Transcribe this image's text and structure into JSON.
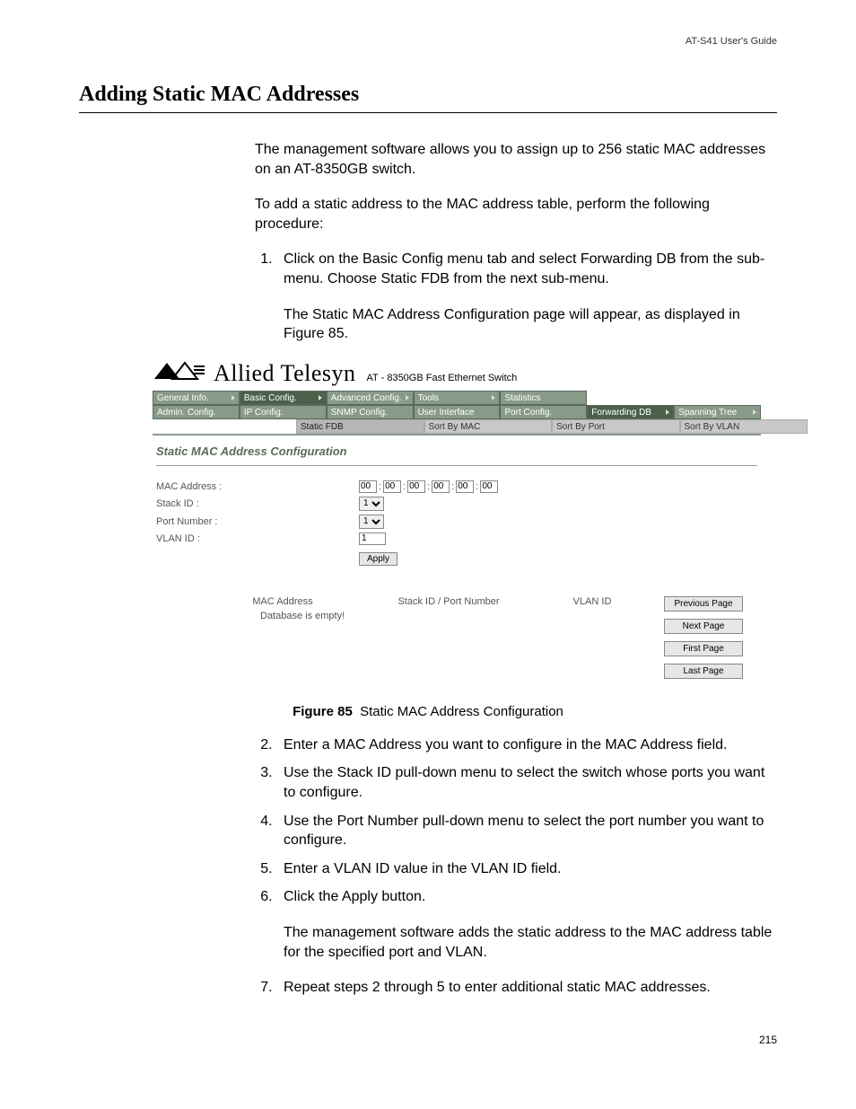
{
  "header": {
    "guide": "AT-S41 User's Guide"
  },
  "heading": "Adding Static MAC Addresses",
  "intro": {
    "p1": "The management software allows you to assign up to 256 static MAC addresses on an AT-8350GB switch.",
    "p2": "To add a static address to the MAC address table, perform the following procedure:"
  },
  "steps_a": {
    "s1": "Click on the Basic Config menu tab and select Forwarding DB from the sub-menu. Choose Static FDB from the next sub-menu.",
    "s1_note": "The Static MAC Address Configuration page will appear, as displayed in Figure 85."
  },
  "screenshot": {
    "logo_text": "Allied Telesyn",
    "logo_sub": "AT - 8350GB Fast Ethernet Switch",
    "tabs_row1": [
      "General Info.",
      "Basic Config.",
      "Advanced Config.",
      "Tools",
      "Statistics"
    ],
    "tabs_row2": [
      "Admin. Config.",
      "IP Config.",
      "SNMP Config.",
      "User Interface",
      "Port Config.",
      "Forwarding DB",
      "Spanning Tree"
    ],
    "tabs_row3": [
      "Static FDB",
      "Sort By MAC",
      "Sort By Port",
      "Sort By VLAN"
    ],
    "panel_title": "Static MAC Address Configuration",
    "form": {
      "mac_label": "MAC Address :",
      "mac_bytes": [
        "00",
        "00",
        "00",
        "00",
        "00",
        "00"
      ],
      "stack_label": "Stack ID :",
      "stack_value": "1",
      "port_label": "Port Number :",
      "port_value": "1",
      "vlan_label": "VLAN ID :",
      "vlan_value": "1",
      "apply": "Apply"
    },
    "nav": {
      "prev": "Previous Page",
      "next": "Next Page",
      "first": "First Page",
      "last": "Last Page"
    },
    "table": {
      "col1": "MAC Address",
      "col2": "Stack ID / Port Number",
      "col3": "VLAN ID",
      "empty": "Database is empty!"
    }
  },
  "figure": {
    "label": "Figure 85",
    "caption": "Static MAC Address Configuration"
  },
  "steps_b": {
    "s2": "Enter a MAC Address you want to configure in the MAC Address field.",
    "s3": "Use the Stack ID pull-down menu to select the switch whose ports you want to configure.",
    "s4": "Use the Port Number pull-down menu to select the port number you want to configure.",
    "s5": "Enter a VLAN ID value in the VLAN ID field.",
    "s6": "Click the Apply button.",
    "s6_note": "The management software adds the static address to the MAC address table for the specified port and VLAN.",
    "s7": "Repeat steps 2 through 5 to enter additional static MAC addresses."
  },
  "page_number": "215"
}
